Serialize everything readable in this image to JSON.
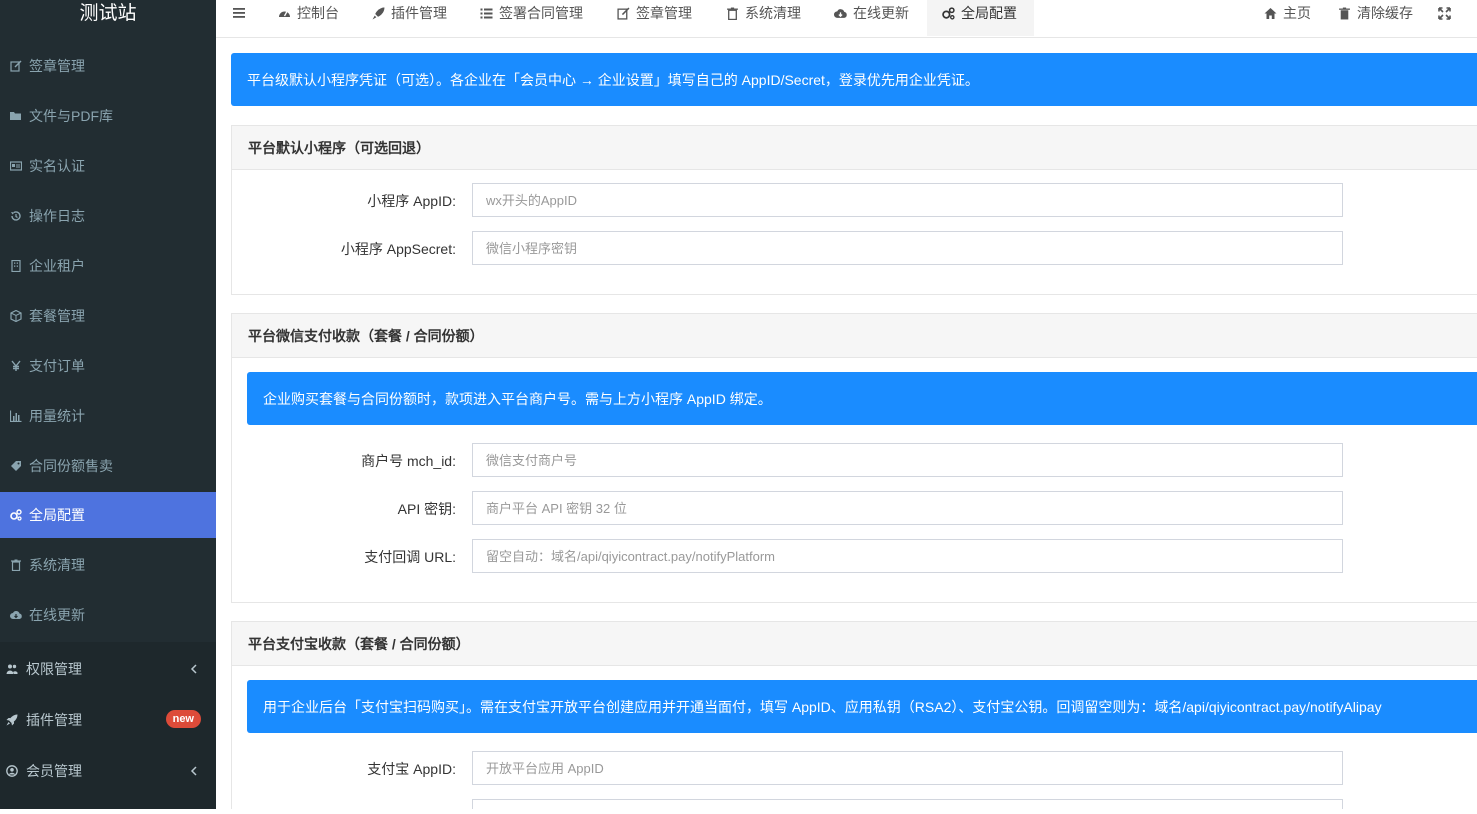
{
  "sidebar": {
    "title": "测试站",
    "items": [
      {
        "label": "签章管理",
        "icon": "edit-icon"
      },
      {
        "label": "文件与PDF库",
        "icon": "folder-open-icon"
      },
      {
        "label": "实名认证",
        "icon": "id-card-icon"
      },
      {
        "label": "操作日志",
        "icon": "history-icon"
      },
      {
        "label": "企业租户",
        "icon": "building-icon"
      },
      {
        "label": "套餐管理",
        "icon": "cube-icon"
      },
      {
        "label": "支付订单",
        "icon": "yen-icon"
      },
      {
        "label": "用量统计",
        "icon": "bar-chart-icon"
      },
      {
        "label": "合同份额售卖",
        "icon": "tag-icon"
      },
      {
        "label": "全局配置",
        "icon": "gears-icon"
      },
      {
        "label": "系统清理",
        "icon": "trash-icon"
      },
      {
        "label": "在线更新",
        "icon": "cloud-download-icon"
      }
    ],
    "groups": [
      {
        "label": "权限管理",
        "icon": "users-icon"
      },
      {
        "label": "插件管理",
        "icon": "rocket-icon",
        "badge": "new"
      },
      {
        "label": "会员管理",
        "icon": "user-circle-icon"
      }
    ]
  },
  "topnav": {
    "tabs": [
      {
        "label": "控制台",
        "icon": "dashboard-icon"
      },
      {
        "label": "插件管理",
        "icon": "rocket-icon"
      },
      {
        "label": "签署合同管理",
        "icon": "list-icon"
      },
      {
        "label": "签章管理",
        "icon": "edit-icon"
      },
      {
        "label": "系统清理",
        "icon": "trash-icon"
      },
      {
        "label": "在线更新",
        "icon": "cloud-download-icon"
      },
      {
        "label": "全局配置",
        "icon": "gears-icon"
      }
    ],
    "right": [
      {
        "label": "主页",
        "icon": "home-icon"
      },
      {
        "label": "清除缓存",
        "icon": "trash-icon"
      }
    ],
    "fullscreen_icon": "expand-icon"
  },
  "main": {
    "top_alert": "平台级默认小程序凭证（可选）。各企业在「会员中心 → 企业设置」填写自己的 AppID/Secret，登录优先用企业凭证。",
    "miniapp": {
      "title": "平台默认小程序（可选回退）",
      "fields": [
        {
          "label": "小程序 AppID:",
          "placeholder": "wx开头的AppID"
        },
        {
          "label": "小程序 AppSecret:",
          "placeholder": "微信小程序密钥"
        }
      ]
    },
    "wechat_pay": {
      "title": "平台微信支付收款（套餐 / 合同份额）",
      "alert": "企业购买套餐与合同份额时，款项进入平台商户号。需与上方小程序 AppID 绑定。",
      "fields": [
        {
          "label": "商户号 mch_id:",
          "placeholder": "微信支付商户号"
        },
        {
          "label": "API 密钥:",
          "placeholder": "商户平台 API 密钥 32 位"
        },
        {
          "label": "支付回调 URL:",
          "placeholder": "留空自动：域名/api/qiyicontract.pay/notifyPlatform"
        }
      ]
    },
    "alipay": {
      "title": "平台支付宝收款（套餐 / 合同份额）",
      "alert": "用于企业后台「支付宝扫码购买」。需在支付宝开放平台创建应用并开通当面付，填写 AppID、应用私钥（RSA2）、支付宝公钥。回调留空则为：域名/api/qiyicontract.pay/notifyAlipay",
      "fields": [
        {
          "label": "支付宝 AppID:",
          "placeholder": "开放平台应用 AppID"
        }
      ]
    }
  },
  "colors": {
    "sidebar_bg": "#222d32",
    "active_item": "#4e73df",
    "alert_blue": "#1a8cff",
    "badge_red": "#dd4b39"
  }
}
